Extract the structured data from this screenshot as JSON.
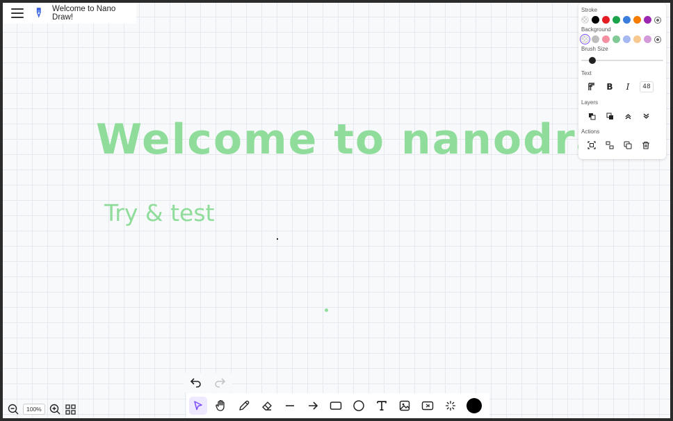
{
  "header": {
    "app_title": "Welcome to Nano Draw!"
  },
  "canvas": {
    "big_text": "Welcome to nanodraw",
    "sub_text": "Try & test",
    "text_color": "#8fdc9b"
  },
  "panel": {
    "stroke_label": "Stroke",
    "stroke_colors": [
      "transparent",
      "#000000",
      "#e51c23",
      "#1aa34a",
      "#3b7ddd",
      "#f57c00",
      "#9c27b0"
    ],
    "background_label": "Background",
    "background_colors": [
      "transparent",
      "#bdbdbd",
      "#f48fa1",
      "#81c995",
      "#a5b8f0",
      "#f7c98f",
      "#d39ad9"
    ],
    "brush_size_label": "Brush Size",
    "brush_size": 0.1,
    "text_label": "Text",
    "font_size": "48",
    "layers_label": "Layers",
    "actions_label": "Actions"
  },
  "toolbar": {
    "tools": [
      "select-icon",
      "hand-icon",
      "pencil-icon",
      "eraser-icon",
      "line-icon",
      "arrow-icon",
      "rectangle-icon",
      "ellipse-icon",
      "text-icon",
      "image-icon",
      "embed-icon",
      "laser-icon"
    ],
    "active_tool": "select-icon",
    "current_color": "#000000"
  },
  "zoom": {
    "level": "100%"
  },
  "accent_color": "#7b4dff"
}
